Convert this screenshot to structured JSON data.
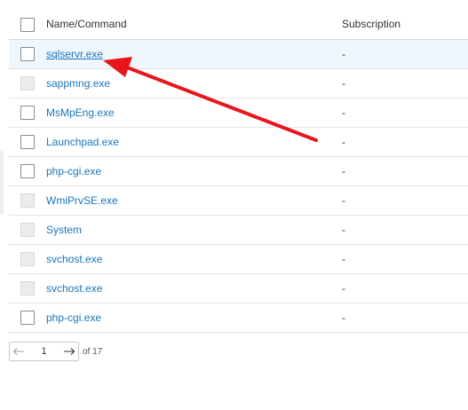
{
  "header": {
    "name_col": "Name/Command",
    "subscription_col": "Subscription"
  },
  "rows": [
    {
      "name": "sqlservr.exe",
      "subscription": "-",
      "checkbox_enabled": true
    },
    {
      "name": "sappmng.exe",
      "subscription": "-",
      "checkbox_enabled": false
    },
    {
      "name": "MsMpEng.exe",
      "subscription": "-",
      "checkbox_enabled": true
    },
    {
      "name": "Launchpad.exe",
      "subscription": "-",
      "checkbox_enabled": true
    },
    {
      "name": "php-cgi.exe",
      "subscription": "-",
      "checkbox_enabled": true
    },
    {
      "name": "WmiPrvSE.exe",
      "subscription": "-",
      "checkbox_enabled": false
    },
    {
      "name": "System",
      "subscription": "-",
      "checkbox_enabled": false
    },
    {
      "name": "svchost.exe",
      "subscription": "-",
      "checkbox_enabled": false
    },
    {
      "name": "svchost.exe",
      "subscription": "-",
      "checkbox_enabled": false
    },
    {
      "name": "php-cgi.exe",
      "subscription": "-",
      "checkbox_enabled": true
    }
  ],
  "pager": {
    "current_page": "1",
    "of_label": "of 17"
  },
  "colors": {
    "link": "#1a75bb",
    "arrow": "#e8161b",
    "highlight_row": "#f0f7fc"
  }
}
